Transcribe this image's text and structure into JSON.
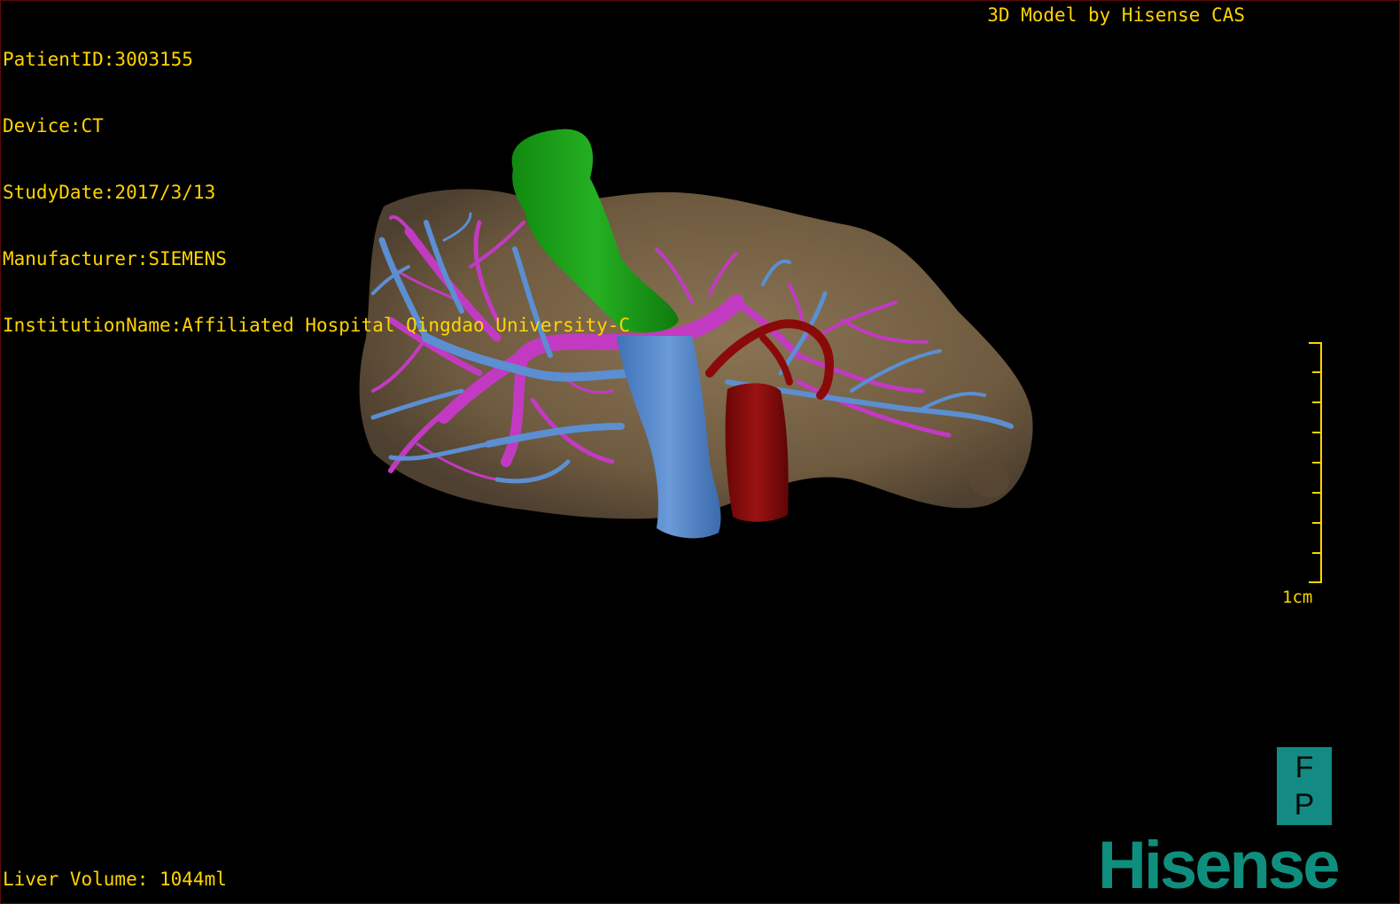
{
  "patient_info": {
    "patient_id": "PatientID:3003155",
    "device": "Device:CT",
    "study_date": "StudyDate:2017/3/13",
    "manufacturer": "Manufacturer:SIEMENS",
    "institution": "InstitutionName:Affiliated Hospital Qingdao University-C"
  },
  "header": {
    "model_credit": "3D Model by Hisense CAS"
  },
  "footer": {
    "liver_volume": "Liver Volume: 1044ml"
  },
  "scale_bar": {
    "label": "1cm"
  },
  "orientation": {
    "top_letter": "F",
    "bottom_letter": "P"
  },
  "logo": {
    "text": "Hisense"
  },
  "colors": {
    "overlay_text": "#ffd400",
    "liver": "#7a6548",
    "hepatic_vein": "#5b8fd1",
    "portal_vein": "#c23ac2",
    "gallbladder": "#1a9a18",
    "artery": "#8a0a0a",
    "logo": "#0e8f7e"
  }
}
